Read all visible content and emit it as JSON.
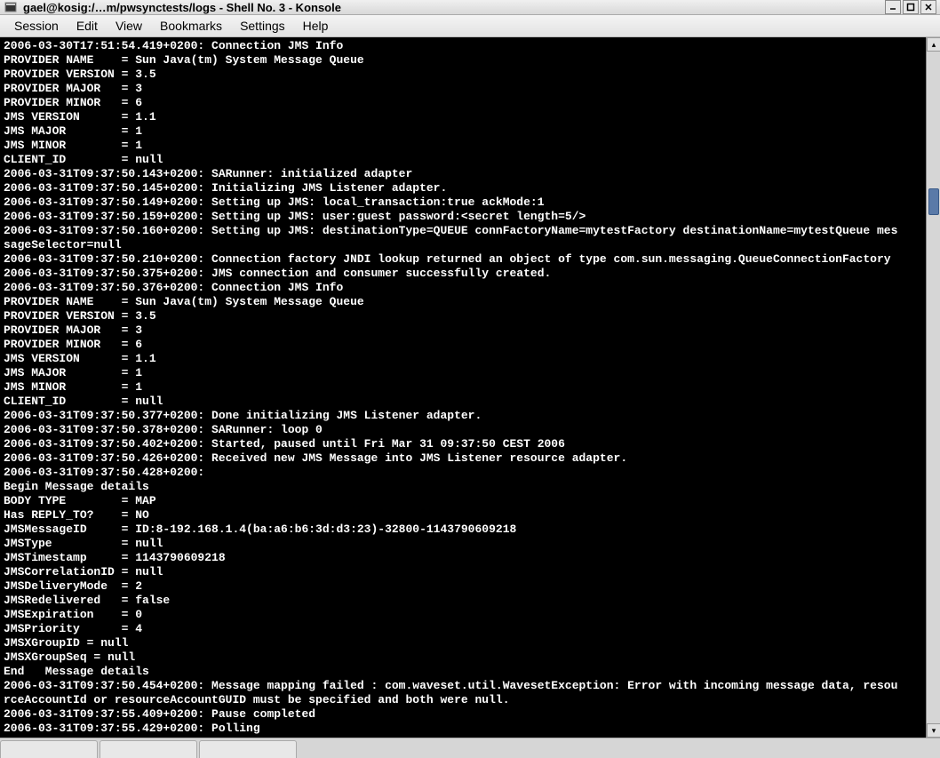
{
  "titlebar": {
    "title": "gael@kosig:/…m/pwsynctests/logs - Shell No. 3 - Konsole"
  },
  "menu": {
    "session": "Session",
    "edit": "Edit",
    "view": "View",
    "bookmarks": "Bookmarks",
    "settings": "Settings",
    "help": "Help"
  },
  "terminal": {
    "lines": [
      "2006-03-30T17:51:54.419+0200: Connection JMS Info",
      "PROVIDER NAME    = Sun Java(tm) System Message Queue",
      "PROVIDER VERSION = 3.5",
      "PROVIDER MAJOR   = 3",
      "PROVIDER MINOR   = 6",
      "JMS VERSION      = 1.1",
      "JMS MAJOR        = 1",
      "JMS MINOR        = 1",
      "CLIENT_ID        = null",
      "2006-03-31T09:37:50.143+0200: SARunner: initialized adapter",
      "2006-03-31T09:37:50.145+0200: Initializing JMS Listener adapter.",
      "2006-03-31T09:37:50.149+0200: Setting up JMS: local_transaction:true ackMode:1",
      "2006-03-31T09:37:50.159+0200: Setting up JMS: user:guest password:<secret length=5/>",
      "2006-03-31T09:37:50.160+0200: Setting up JMS: destinationType=QUEUE connFactoryName=mytestFactory destinationName=mytestQueue mes",
      "sageSelector=null",
      "2006-03-31T09:37:50.210+0200: Connection factory JNDI lookup returned an object of type com.sun.messaging.QueueConnectionFactory",
      "2006-03-31T09:37:50.375+0200: JMS connection and consumer successfully created.",
      "2006-03-31T09:37:50.376+0200: Connection JMS Info",
      "PROVIDER NAME    = Sun Java(tm) System Message Queue",
      "PROVIDER VERSION = 3.5",
      "PROVIDER MAJOR   = 3",
      "PROVIDER MINOR   = 6",
      "JMS VERSION      = 1.1",
      "JMS MAJOR        = 1",
      "JMS MINOR        = 1",
      "CLIENT_ID        = null",
      "2006-03-31T09:37:50.377+0200: Done initializing JMS Listener adapter.",
      "2006-03-31T09:37:50.378+0200: SARunner: loop 0",
      "2006-03-31T09:37:50.402+0200: Started, paused until Fri Mar 31 09:37:50 CEST 2006",
      "2006-03-31T09:37:50.426+0200: Received new JMS Message into JMS Listener resource adapter.",
      "2006-03-31T09:37:50.428+0200:",
      "Begin Message details",
      "BODY TYPE        = MAP",
      "Has REPLY_TO?    = NO",
      "JMSMessageID     = ID:8-192.168.1.4(ba:a6:b6:3d:d3:23)-32800-1143790609218",
      "JMSType          = null",
      "JMSTimestamp     = 1143790609218",
      "JMSCorrelationID = null",
      "JMSDeliveryMode  = 2",
      "JMSRedelivered   = false",
      "JMSExpiration    = 0",
      "JMSPriority      = 4",
      "JMSXGroupID = null",
      "JMSXGroupSeq = null",
      "End   Message details",
      "2006-03-31T09:37:50.454+0200: Message mapping failed : com.waveset.util.WavesetException: Error with incoming message data, resou",
      "rceAccountId or resourceAccountGUID must be specified and both were null.",
      "2006-03-31T09:37:55.409+0200: Pause completed",
      "2006-03-31T09:37:55.429+0200: Polling"
    ]
  }
}
